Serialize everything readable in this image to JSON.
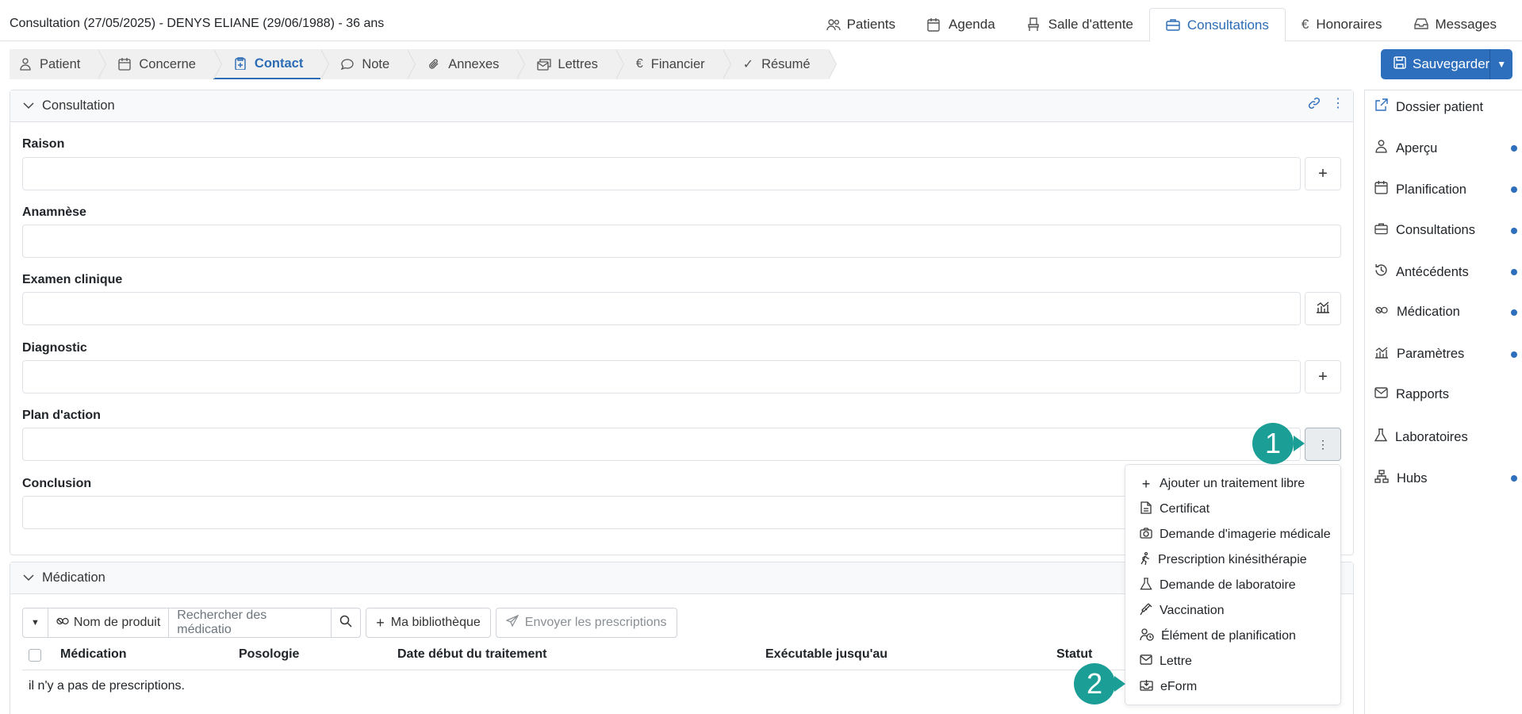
{
  "header": {
    "title": "Consultation (27/05/2025) - DENYS ELIANE (29/06/1988) - 36 ans",
    "nav": [
      {
        "label": "Patients",
        "icon": "users-icon"
      },
      {
        "label": "Agenda",
        "icon": "calendar-icon"
      },
      {
        "label": "Salle d'attente",
        "icon": "chair-icon"
      },
      {
        "label": "Consultations",
        "icon": "briefcase-icon",
        "active": true
      },
      {
        "label": "Honoraires",
        "icon": "euro-icon"
      },
      {
        "label": "Messages",
        "icon": "inbox-icon"
      }
    ]
  },
  "tabs": [
    {
      "label": "Patient",
      "icon": "person-icon"
    },
    {
      "label": "Concerne",
      "icon": "calendar-icon"
    },
    {
      "label": "Contact",
      "icon": "clipboard-plus-icon",
      "active": true
    },
    {
      "label": "Note",
      "icon": "chat-icon"
    },
    {
      "label": "Annexes",
      "icon": "paperclip-icon"
    },
    {
      "label": "Lettres",
      "icon": "envelopes-icon"
    },
    {
      "label": "Financier",
      "icon": "euro-icon"
    },
    {
      "label": "Résumé",
      "icon": "check-icon"
    }
  ],
  "save": {
    "label": "Sauvegarder"
  },
  "consultation": {
    "title": "Consultation",
    "fields": {
      "raison": "Raison",
      "anamnese": "Anamnèse",
      "examen": "Examen clinique",
      "diagnostic": "Diagnostic",
      "plan": "Plan d'action",
      "conclusion": "Conclusion"
    }
  },
  "sidebar": {
    "items": [
      {
        "label": "Dossier patient",
        "icon": "external-link-icon",
        "dot": false
      },
      {
        "label": "Aperçu",
        "icon": "person-icon",
        "dot": true
      },
      {
        "label": "Planification",
        "icon": "calendar-icon",
        "dot": true
      },
      {
        "label": "Consultations",
        "icon": "briefcase-icon",
        "dot": true
      },
      {
        "label": "Antécédents",
        "icon": "history-icon",
        "dot": true
      },
      {
        "label": "Médication",
        "icon": "pills-icon",
        "dot": true
      },
      {
        "label": "Paramètres",
        "icon": "chart-icon",
        "dot": true
      },
      {
        "label": "Rapports",
        "icon": "envelope-icon",
        "dot": false
      },
      {
        "label": "Laboratoires",
        "icon": "flask-icon",
        "dot": false
      },
      {
        "label": "Hubs",
        "icon": "network-icon",
        "dot": true
      }
    ]
  },
  "menu": {
    "items": [
      {
        "label": "Ajouter un traitement libre",
        "icon": "plus-icon"
      },
      {
        "label": "Certificat",
        "icon": "document-icon"
      },
      {
        "label": "Demande d'imagerie médicale",
        "icon": "camera-icon"
      },
      {
        "label": "Prescription kinésithérapie",
        "icon": "walking-icon"
      },
      {
        "label": "Demande de laboratoire",
        "icon": "flask-icon"
      },
      {
        "label": "Vaccination",
        "icon": "syringe-icon"
      },
      {
        "label": "Élément de planification",
        "icon": "person-clock-icon"
      },
      {
        "label": "Lettre",
        "icon": "envelope-icon"
      },
      {
        "label": "eForm",
        "icon": "inbox-download-icon"
      }
    ]
  },
  "markers": {
    "one": "1",
    "two": "2"
  },
  "medication": {
    "title": "Médication",
    "filter_label": "Nom de produit",
    "search_placeholder": "Rechercher des médicatio",
    "library_label": "Ma bibliothèque",
    "send_label": "Envoyer les prescriptions",
    "columns": [
      "Médication",
      "Posologie",
      "Date début du traitement",
      "Exécutable jusqu'au",
      "Statut"
    ],
    "empty": "il n'y a pas de prescriptions."
  },
  "colors": {
    "accent": "#2e6fbd",
    "marker": "#1a9e95"
  }
}
